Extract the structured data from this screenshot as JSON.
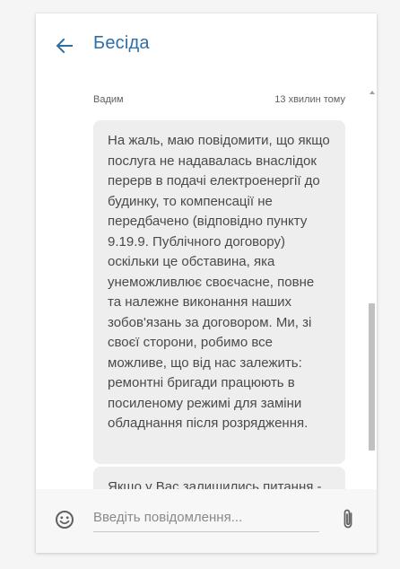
{
  "header": {
    "title": "Бесіда",
    "back_icon": "arrow-left-icon"
  },
  "messages": [
    {
      "author": "Вадим",
      "time": "13 хвилин тому",
      "text": "На жаль, маю повідомити, що якщо послуга не надавалась внаслідок перерв в подачі електроенергії до будинку, то компенсації не передбачено (відповідно пункту 9.19.9. Публічного договору) оскільки це обставина, яка унеможливлює своєчасне, повне та належне виконання наших зобов'язань за договором. Ми, зі своєї сторони, робимо все можливе, що від нас залежить: ремонтні бригади працюють в посиленому режимі для заміни обладнання після розрядження."
    },
    {
      "text": "Якщо у Вас залишились питання - пишіть"
    }
  ],
  "composer": {
    "placeholder": "Введіть повідомлення...",
    "value": "",
    "emoji_icon": "smiley-icon",
    "attach_icon": "paperclip-icon"
  },
  "colors": {
    "accent": "#2f6ea5",
    "bubble": "#eeeeee",
    "text": "#4a4a4a"
  }
}
